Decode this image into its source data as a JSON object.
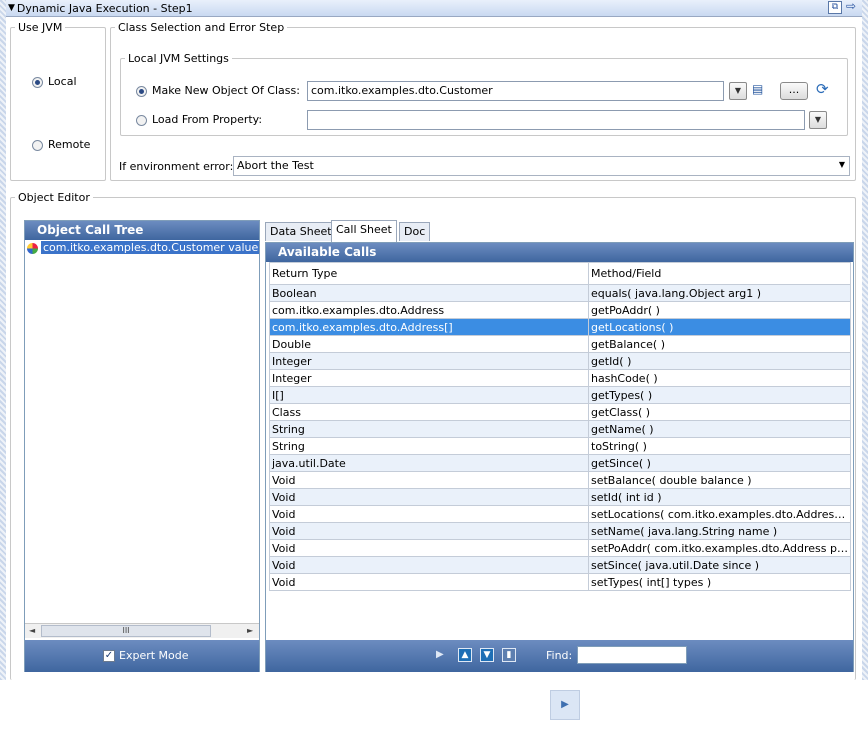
{
  "window": {
    "title": "Dynamic Java Execution - Step1"
  },
  "use_jvm": {
    "legend": "Use JVM",
    "local_label": "Local",
    "remote_label": "Remote",
    "selected": "Local"
  },
  "class_selection": {
    "legend": "Class Selection and Error Step",
    "local_jvm_legend": "Local JVM Settings",
    "make_new_label": "Make New Object Of Class:",
    "make_new_value": "com.itko.examples.dto.Customer",
    "load_from_label": "Load From Property:",
    "load_from_value": "",
    "browse_label": "...",
    "env_error_label": "If environment error:",
    "env_error_value": "Abort the Test"
  },
  "object_editor": {
    "legend": "Object Editor",
    "tree_header": "Object Call Tree",
    "tree_item": "com.itko.examples.dto.Customer value",
    "scroll_grip": "III",
    "expert_mode_label": "Expert Mode",
    "expert_mode_checked": true
  },
  "tabs": [
    "Data Sheet",
    "Call Sheet",
    "Doc"
  ],
  "active_tab": "Call Sheet",
  "calls": {
    "header": "Available Calls",
    "columns": [
      "Return Type",
      "Method/Field"
    ],
    "rows": [
      [
        "Boolean",
        "equals( java.lang.Object arg1 )"
      ],
      [
        "com.itko.examples.dto.Address",
        "getPoAddr( )"
      ],
      [
        "com.itko.examples.dto.Address[]",
        "getLocations( )"
      ],
      [
        "Double",
        "getBalance( )"
      ],
      [
        "Integer",
        "getId( )"
      ],
      [
        "Integer",
        "hashCode( )"
      ],
      [
        "I[]",
        "getTypes( )"
      ],
      [
        "Class",
        "getClass( )"
      ],
      [
        "String",
        "getName( )"
      ],
      [
        "String",
        "toString( )"
      ],
      [
        "java.util.Date",
        "getSince( )"
      ],
      [
        "Void",
        "setBalance( double balance )"
      ],
      [
        "Void",
        "setId( int id )"
      ],
      [
        "Void",
        "setLocations( com.itko.examples.dto.Address[..."
      ],
      [
        "Void",
        "setName( java.lang.String name )"
      ],
      [
        "Void",
        "setPoAddr( com.itko.examples.dto.Address po..."
      ],
      [
        "Void",
        "setSince( java.util.Date since )"
      ],
      [
        "Void",
        "setTypes( int[] types )"
      ]
    ],
    "selected_row": 2,
    "find_label": "Find:",
    "find_value": ""
  },
  "icons": {
    "tree_item": "object-icon",
    "toolbar": [
      "play-icon",
      "move-up-icon",
      "move-down-icon",
      "delete-icon"
    ],
    "bottom": "play-icon"
  }
}
